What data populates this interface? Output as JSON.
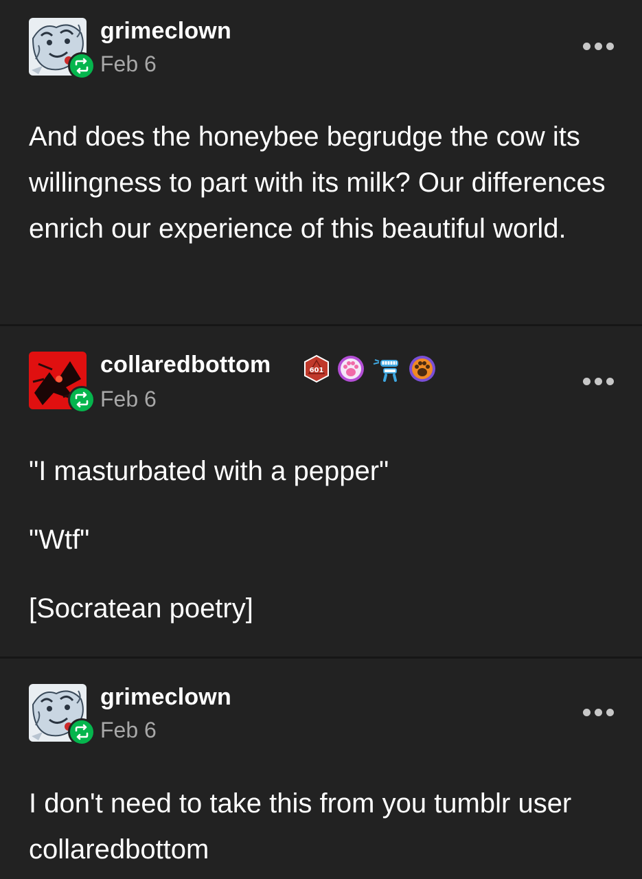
{
  "posts": [
    {
      "username": "grimeclown",
      "date": "Feb 6",
      "avatar_icon": "sketch-avatar-icon",
      "reblog_icon": "reblog-icon",
      "more_icon": "more-options-icon",
      "text": "And does the honeybee begrudge the cow its willingness to part with its milk? Our differences enrich our experience of this beautiful world."
    },
    {
      "username": "collaredbottom",
      "date": "Feb 6",
      "avatar_icon": "red-art-avatar-icon",
      "reblog_icon": "reblog-icon",
      "more_icon": "more-options-icon",
      "badges": [
        {
          "icon": "d20-dice-badge-icon",
          "label": "601",
          "color": "#c0392b"
        },
        {
          "icon": "pink-paw-badge-icon",
          "color": "#b44fd6"
        },
        {
          "icon": "wind-up-teeth-badge-icon",
          "color": "#3fa7e0"
        },
        {
          "icon": "orange-paw-badge-icon",
          "color": "#7a4fd6"
        }
      ],
      "paragraphs": [
        "\"I masturbated with a pepper\"",
        "\"Wtf\"",
        "[Socratean poetry]"
      ]
    },
    {
      "username": "grimeclown",
      "date": "Feb 6",
      "avatar_icon": "sketch-avatar-icon",
      "reblog_icon": "reblog-icon",
      "more_icon": "more-options-icon",
      "text": "I don't need to take this from you tumblr user collaredbottom"
    }
  ],
  "colors": {
    "background": "#222222",
    "divider": "#161616",
    "text": "#ffffff",
    "muted": "#a8a8a8",
    "reblog_green": "#05b54d"
  }
}
